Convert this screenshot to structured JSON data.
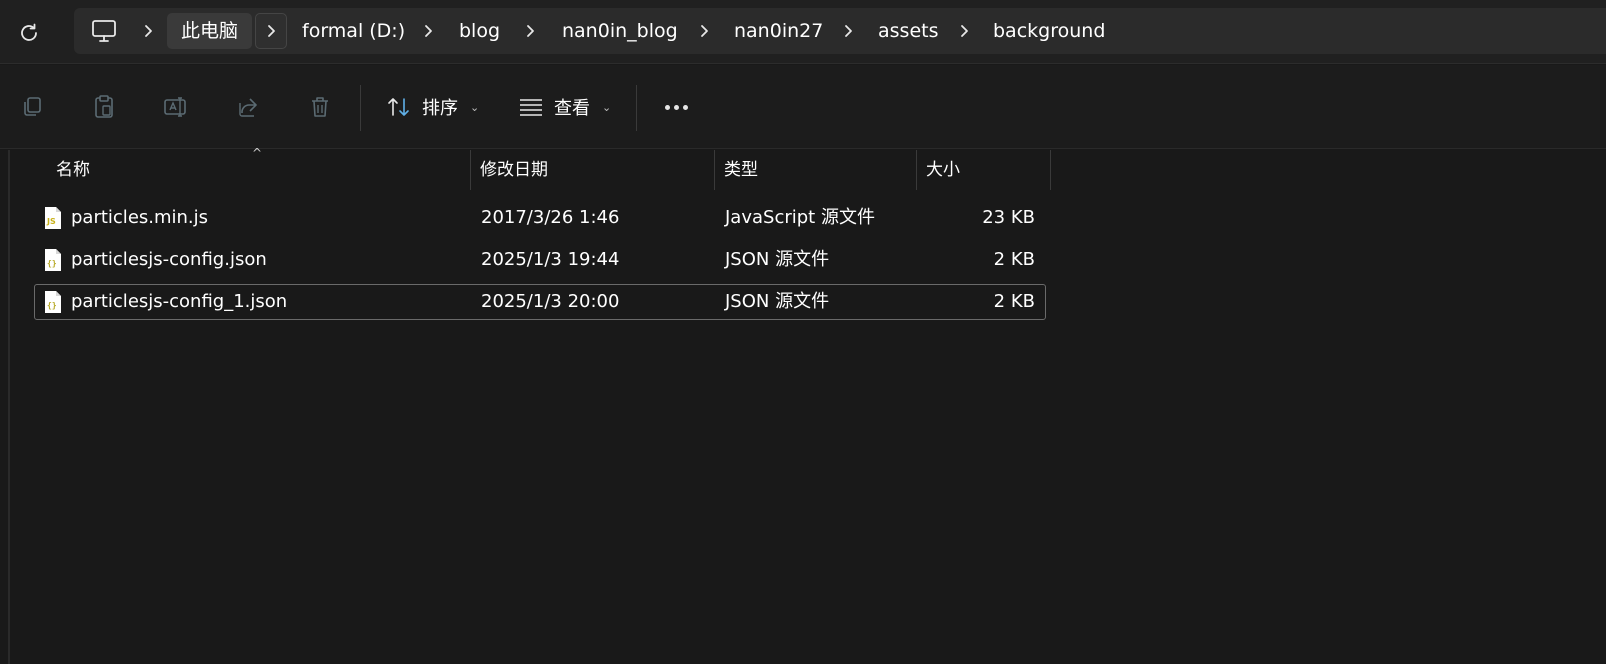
{
  "breadcrumb": {
    "items": [
      "此电脑",
      "formal (D:)",
      "blog",
      "nan0in_blog",
      "nan0in27",
      "assets",
      "background"
    ]
  },
  "toolbar": {
    "sort_label": "排序",
    "view_label": "查看"
  },
  "columns": {
    "name": "名称",
    "date": "修改日期",
    "type": "类型",
    "size": "大小"
  },
  "files": [
    {
      "name": "particles.min.js",
      "date": "2017/3/26 1:46",
      "type": "JavaScript 源文件",
      "size": "23 KB",
      "icon": "js-file-icon"
    },
    {
      "name": "particlesjs-config.json",
      "date": "2025/1/3 19:44",
      "type": "JSON 源文件",
      "size": "2 KB",
      "icon": "json-file-icon"
    },
    {
      "name": "particlesjs-config_1.json",
      "date": "2025/1/3 20:00",
      "type": "JSON 源文件",
      "size": "2 KB",
      "icon": "json-file-icon"
    }
  ],
  "colors": {
    "background": "#191919",
    "accent_blue": "#60b0e8",
    "js_icon": "#c9b21a",
    "json_icon": "#b6a824"
  }
}
